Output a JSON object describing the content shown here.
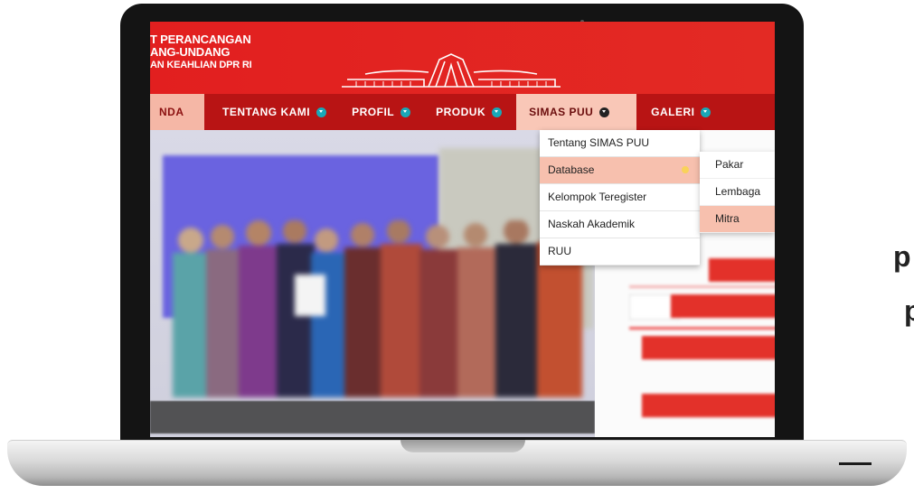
{
  "header": {
    "brand_lines": [
      "T PERANCANGAN",
      "ANG-UNDANG",
      "AN KEAHLIAN DPR RI"
    ]
  },
  "nav": {
    "items": [
      {
        "label": "NDA",
        "state": "active",
        "chevron": false
      },
      {
        "label": "TENTANG KAMI",
        "state": "normal",
        "chevron": true
      },
      {
        "label": "PROFIL",
        "state": "normal",
        "chevron": true
      },
      {
        "label": "PRODUK",
        "state": "normal",
        "chevron": true
      },
      {
        "label": "SIMAS PUU",
        "state": "hot",
        "chevron": true
      },
      {
        "label": "GALERI",
        "state": "normal",
        "chevron": true
      }
    ]
  },
  "dropdown": {
    "items": [
      "Tentang SIMAS PUU",
      "Database",
      "Kelompok Teregister",
      "Naskah Akademik",
      "RUU"
    ],
    "active_index": 1
  },
  "submenu": {
    "items": [
      "Pakar",
      "Lembaga",
      "Mitra"
    ],
    "active_index": 2
  },
  "side_text": [
    "p",
    "p"
  ],
  "colors": {
    "header_red": "#e21f1f",
    "nav_red": "#b81414",
    "active_highlight": "#f7c0ae",
    "chevron_teal": "#19a8b8"
  }
}
